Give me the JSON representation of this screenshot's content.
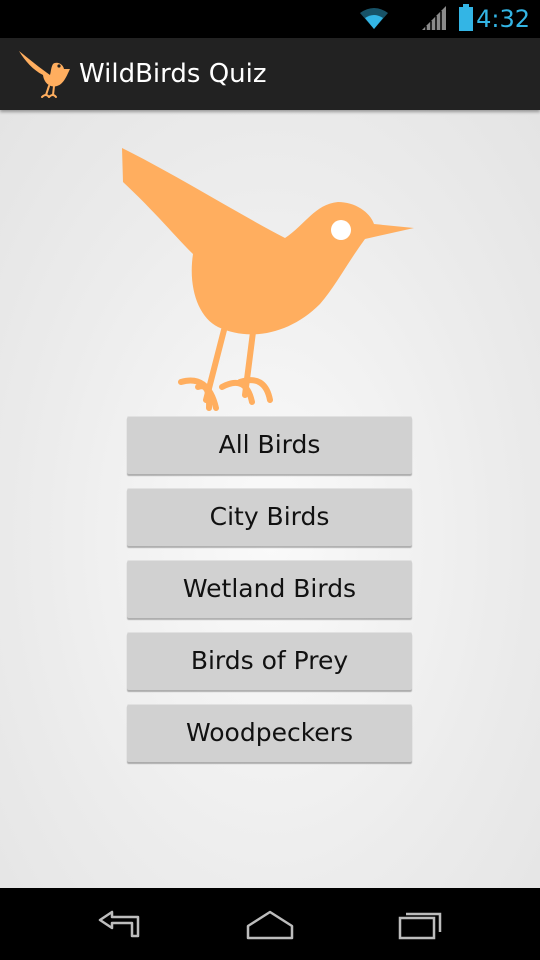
{
  "status_bar": {
    "time": "4:32",
    "icons": [
      "wifi-icon",
      "signal-icon",
      "battery-icon"
    ],
    "accent_color": "#33b5e5"
  },
  "action_bar": {
    "app_title": "WildBirds Quiz",
    "app_icon": "bird-logo-icon"
  },
  "main": {
    "hero_image": "bird-illustration",
    "bird_color": "#ffae5f",
    "buttons": [
      {
        "label": "All Birds"
      },
      {
        "label": "City Birds"
      },
      {
        "label": "Wetland Birds"
      },
      {
        "label": "Birds of Prey"
      },
      {
        "label": "Woodpeckers"
      }
    ]
  },
  "nav_bar": {
    "icons": [
      "back-icon",
      "home-icon",
      "recent-apps-icon"
    ]
  }
}
